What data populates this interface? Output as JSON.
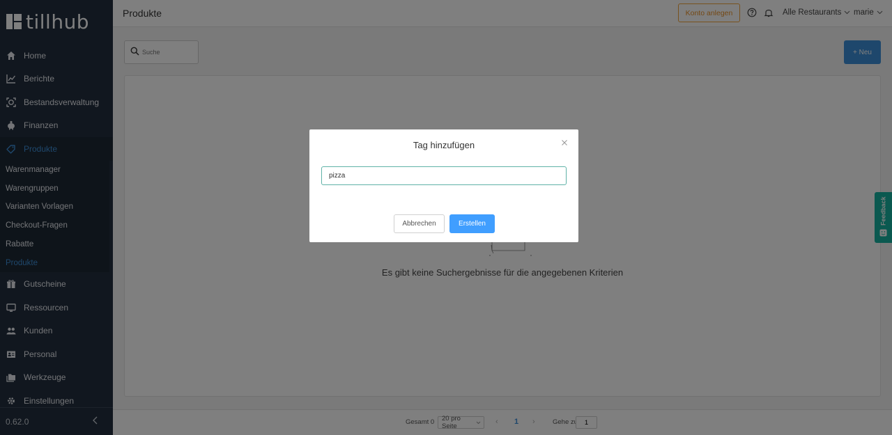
{
  "brand": {
    "name": "tillhub"
  },
  "header": {
    "title": "Produkte",
    "konto_button": "Konto anlegen",
    "restaurant_select": "Alle Restaurants",
    "user_select": "marie"
  },
  "sidebar": {
    "items_top": [
      {
        "label": "Home",
        "icon": "home-icon"
      },
      {
        "label": "Berichte",
        "icon": "chart-icon"
      },
      {
        "label": "Bestandsverwaltung",
        "icon": "inventory-icon"
      },
      {
        "label": "Finanzen",
        "icon": "piggy-bank-icon"
      },
      {
        "label": "Produkte",
        "icon": "tag-icon"
      }
    ],
    "sub_items": [
      {
        "label": "Warenmanager"
      },
      {
        "label": "Warengruppen"
      },
      {
        "label": "Varianten Vorlagen"
      },
      {
        "label": "Checkout-Fragen"
      },
      {
        "label": "Rabatte"
      },
      {
        "label": "Produkte"
      }
    ],
    "items_bottom": [
      {
        "label": "Gutscheine",
        "icon": "gift-icon"
      },
      {
        "label": "Ressourcen",
        "icon": "monitor-icon"
      },
      {
        "label": "Kunden",
        "icon": "users-icon"
      },
      {
        "label": "Personal",
        "icon": "id-card-icon"
      },
      {
        "label": "Werkzeuge",
        "icon": "folders-icon"
      },
      {
        "label": "Einstellungen",
        "icon": "gear-icon"
      }
    ],
    "version": "0.62.0"
  },
  "main": {
    "search_placeholder": "Suche",
    "new_button": "+ Neu",
    "empty_text": "Es gibt keine Suchergebnisse für die angegebenen Kriterien"
  },
  "pagination": {
    "total_label": "Gesamt 0",
    "page_size": "20 pro Seite",
    "current_page": "1",
    "goto_label": "Gehe zu",
    "goto_value": "1"
  },
  "feedback": {
    "label": "Feedback"
  },
  "modal": {
    "title": "Tag hinzufügen",
    "input_value": "pizza",
    "cancel_label": "Abbrechen",
    "create_label": "Erstellen"
  },
  "colors": {
    "sidebar_bg": "#232f3e",
    "accent_blue": "#3d8fd8",
    "konto_orange": "#e8922a",
    "feedback_teal": "#16b3a0",
    "primary_button": "#409eff"
  }
}
